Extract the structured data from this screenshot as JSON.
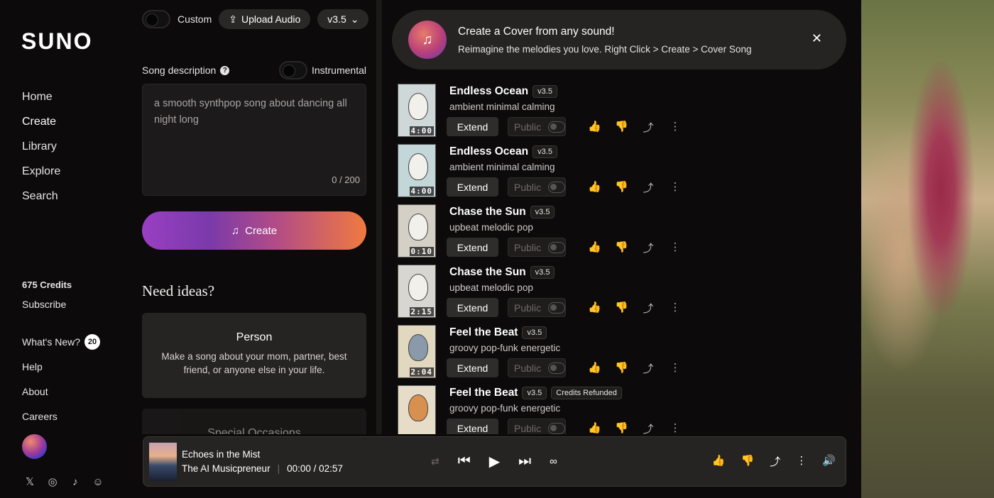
{
  "logo": "SUNO",
  "nav": [
    "Home",
    "Create",
    "Library",
    "Explore",
    "Search"
  ],
  "credits": "675 Credits",
  "subscribe": "Subscribe",
  "lower_links": {
    "whats_new": "What's New?",
    "whats_new_count": "20",
    "help": "Help",
    "about": "About",
    "careers": "Careers"
  },
  "create_panel": {
    "custom_label": "Custom",
    "upload_label": "Upload Audio",
    "version": "v3.5",
    "desc_label": "Song description",
    "instrumental_label": "Instrumental",
    "desc_value": "a smooth synthpop song about dancing all night long",
    "counter": "0 / 200",
    "create_button": "Create",
    "need_ideas": "Need ideas?",
    "cards": [
      {
        "title": "Person",
        "desc": "Make a song about your mom, partner, best friend, or anyone else in your life."
      },
      {
        "title": "Special Occasions",
        "desc": ""
      }
    ]
  },
  "banner": {
    "title": "Create a Cover from any sound!",
    "subtitle": "Reimagine the melodies you love. Right Click > Create > Cover Song"
  },
  "songs": [
    {
      "title": "Endless Ocean",
      "version": "v3.5",
      "style": "ambient minimal calming",
      "duration": "4:00",
      "extend": "Extend",
      "public": "Public",
      "badge": ""
    },
    {
      "title": "Endless Ocean",
      "version": "v3.5",
      "style": "ambient minimal calming",
      "duration": "4:00",
      "extend": "Extend",
      "public": "Public",
      "badge": ""
    },
    {
      "title": "Chase the Sun",
      "version": "v3.5",
      "style": "upbeat melodic pop",
      "duration": "0:10",
      "extend": "Extend",
      "public": "Public",
      "badge": ""
    },
    {
      "title": "Chase the Sun",
      "version": "v3.5",
      "style": "upbeat melodic pop",
      "duration": "2:15",
      "extend": "Extend",
      "public": "Public",
      "badge": ""
    },
    {
      "title": "Feel the Beat",
      "version": "v3.5",
      "style": "groovy pop-funk energetic",
      "duration": "2:04",
      "extend": "Extend",
      "public": "Public",
      "badge": ""
    },
    {
      "title": "Feel the Beat",
      "version": "v3.5",
      "style": "groovy pop-funk energetic",
      "duration": "",
      "extend": "Extend",
      "public": "Public",
      "badge": "Credits Refunded"
    }
  ],
  "player": {
    "title": "Echoes in the Mist",
    "artist": "The AI Musicpreneur",
    "time": "00:00 / 02:57"
  }
}
